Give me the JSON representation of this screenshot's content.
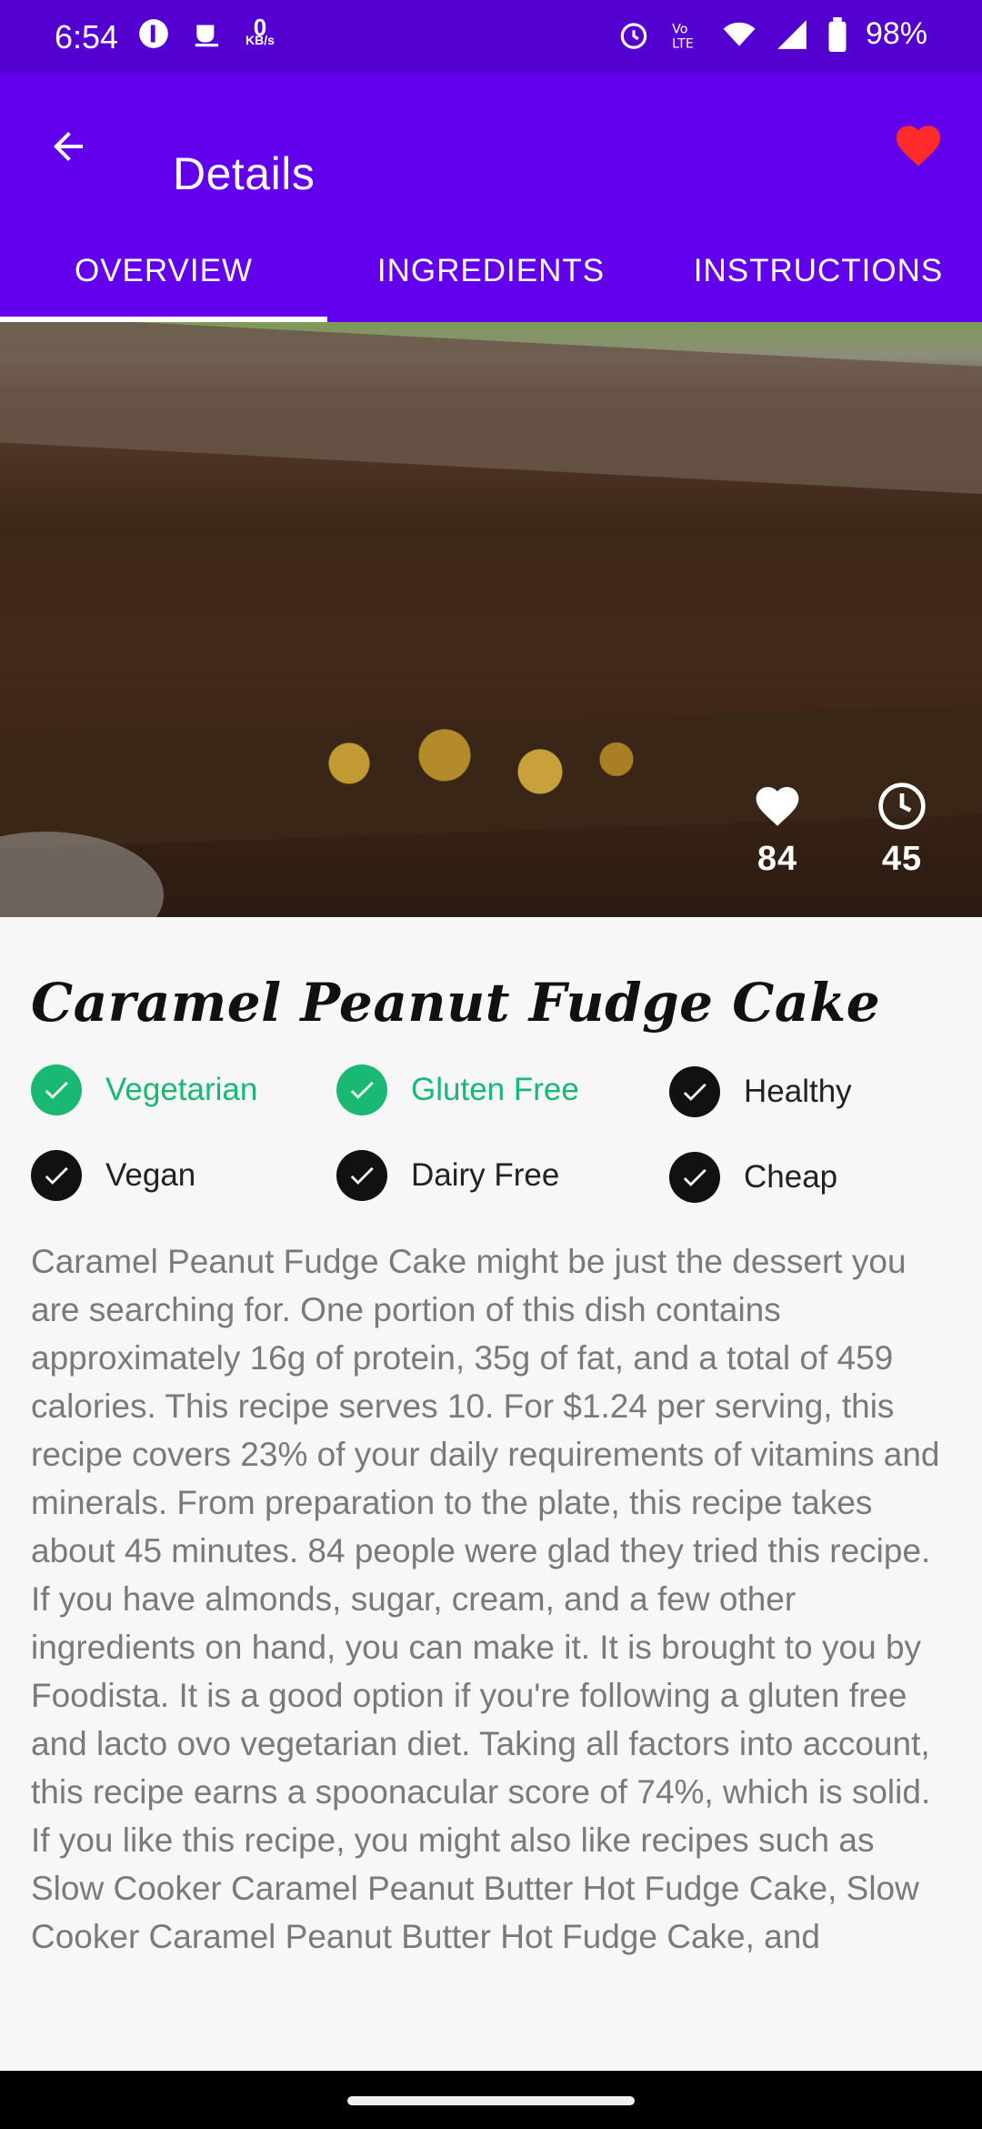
{
  "status_bar": {
    "time": "6:54",
    "speed_value": "0",
    "speed_unit": "KB/s",
    "battery": "98%",
    "icons": [
      "app-icon",
      "coffee-icon",
      "alarm-icon",
      "volte-icon",
      "wifi-icon",
      "signal-icon",
      "battery-icon"
    ]
  },
  "app_bar": {
    "title": "Details",
    "favorite_color": "#ff2a2a",
    "background": "#6200ee"
  },
  "tabs": [
    {
      "label": "OVERVIEW",
      "active": true
    },
    {
      "label": "INGREDIENTS",
      "active": false
    },
    {
      "label": "INSTRUCTIONS",
      "active": false
    }
  ],
  "hero": {
    "likes": "84",
    "minutes": "45"
  },
  "recipe": {
    "title": "Caramel Peanut Fudge Cake",
    "badges": [
      {
        "label": "Vegetarian",
        "active": true
      },
      {
        "label": "Gluten Free",
        "active": true
      },
      {
        "label": "Healthy",
        "active": false
      },
      {
        "label": "Vegan",
        "active": false
      },
      {
        "label": "Dairy Free",
        "active": false
      },
      {
        "label": "Cheap",
        "active": false
      }
    ],
    "active_color": "#19b873",
    "description": "Caramel Peanut Fudge Cake might be just the dessert you are searching for. One portion of this dish contains approximately 16g of protein, 35g of fat, and a total of 459 calories. This recipe serves 10. For $1.24 per serving, this recipe covers 23% of your daily requirements of vitamins and minerals. From preparation to the plate, this recipe takes about 45 minutes. 84 people were glad they tried this recipe. If you have almonds, sugar, cream, and a few other ingredients on hand, you can make it. It is brought to you by Foodista. It is a good option if you're following a gluten free and lacto ovo vegetarian diet. Taking all factors into account, this recipe earns a spoonacular score of 74%, which is solid. If you like this recipe, you might also like recipes such as Slow Cooker Caramel Peanut Butter Hot Fudge Cake, Slow Cooker Caramel Peanut Butter Hot Fudge Cake, and"
  }
}
